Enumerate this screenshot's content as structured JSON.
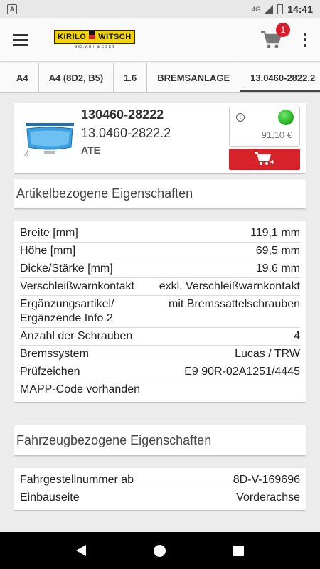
{
  "status": {
    "left_icon": "A",
    "network": "4G",
    "time": "14:41"
  },
  "app": {
    "logo_text_left": "KIRILO",
    "logo_text_right": "WITSCH",
    "logo_sub": "GES.M.B.H & CO KG",
    "cart_count": "1"
  },
  "breadcrumb": [
    "A4",
    "A4 (8D2, B5)",
    "1.6",
    "BREMSANLAGE",
    "13.0460-2822.2"
  ],
  "product": {
    "number": "130460-28222",
    "ref": "13.0460-2822.2",
    "brand": "ATE",
    "price": "91,10 €",
    "info_icon": "i",
    "stock_color": "#2cbc26",
    "cart_button_color": "#d7222a"
  },
  "sections": {
    "article_title": "Artikelbezogene Eigenschaften",
    "vehicle_title": "Fahrzeugbezogene Eigenschaften"
  },
  "article_props": [
    {
      "k": "Breite [mm]",
      "v": "119,1 mm"
    },
    {
      "k": "Höhe [mm]",
      "v": "69,5 mm"
    },
    {
      "k": "Dicke/Stärke [mm]",
      "v": "19,6 mm"
    },
    {
      "k": "Verschleißwarnkontakt",
      "v": "exkl. Verschleißwarnkontakt"
    },
    {
      "k": "Ergänzungsartikel/ Ergänzende Info 2",
      "v": "mit Bremssattelschrauben"
    },
    {
      "k": "Anzahl der Schrauben",
      "v": "4"
    },
    {
      "k": "Bremssystem",
      "v": "Lucas / TRW"
    },
    {
      "k": "Prüfzeichen",
      "v": "E9 90R-02A1251/4445"
    },
    {
      "k": "MAPP-Code vorhanden",
      "v": ""
    }
  ],
  "vehicle_props": [
    {
      "k": "Fahrgestellnummer ab",
      "v": "8D-V-169696"
    },
    {
      "k": "Einbauseite",
      "v": "Vorderachse"
    }
  ]
}
